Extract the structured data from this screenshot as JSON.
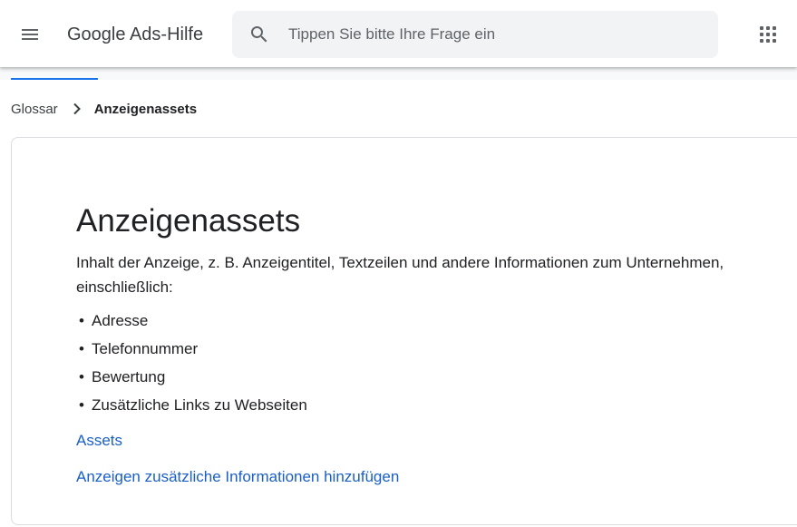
{
  "header": {
    "title": "Google Ads-Hilfe",
    "search_placeholder": "Tippen Sie bitte Ihre Frage ein",
    "icons": {
      "menu": "menu-icon",
      "search": "search-icon",
      "apps": "apps-grid-icon"
    }
  },
  "breadcrumb": {
    "items": [
      {
        "label": "Glossar"
      },
      {
        "label": "Anzeigenassets"
      }
    ]
  },
  "article": {
    "title": "Anzeigenassets",
    "description": "Inhalt der Anzeige, z. B. Anzeigentitel, Textzeilen und andere Informationen zum Unternehmen, einschließlich:",
    "list": [
      "Adresse",
      "Telefonnummer",
      "Bewertung",
      "Zusätzliche Links zu Webseiten"
    ],
    "links": [
      "Assets",
      "Anzeigen zusätzliche Informationen hinzufügen"
    ]
  },
  "colors": {
    "accent": "#1a73e8",
    "link": "#1a5fc7",
    "text": "#202124",
    "search_bg": "#f1f3f4"
  }
}
